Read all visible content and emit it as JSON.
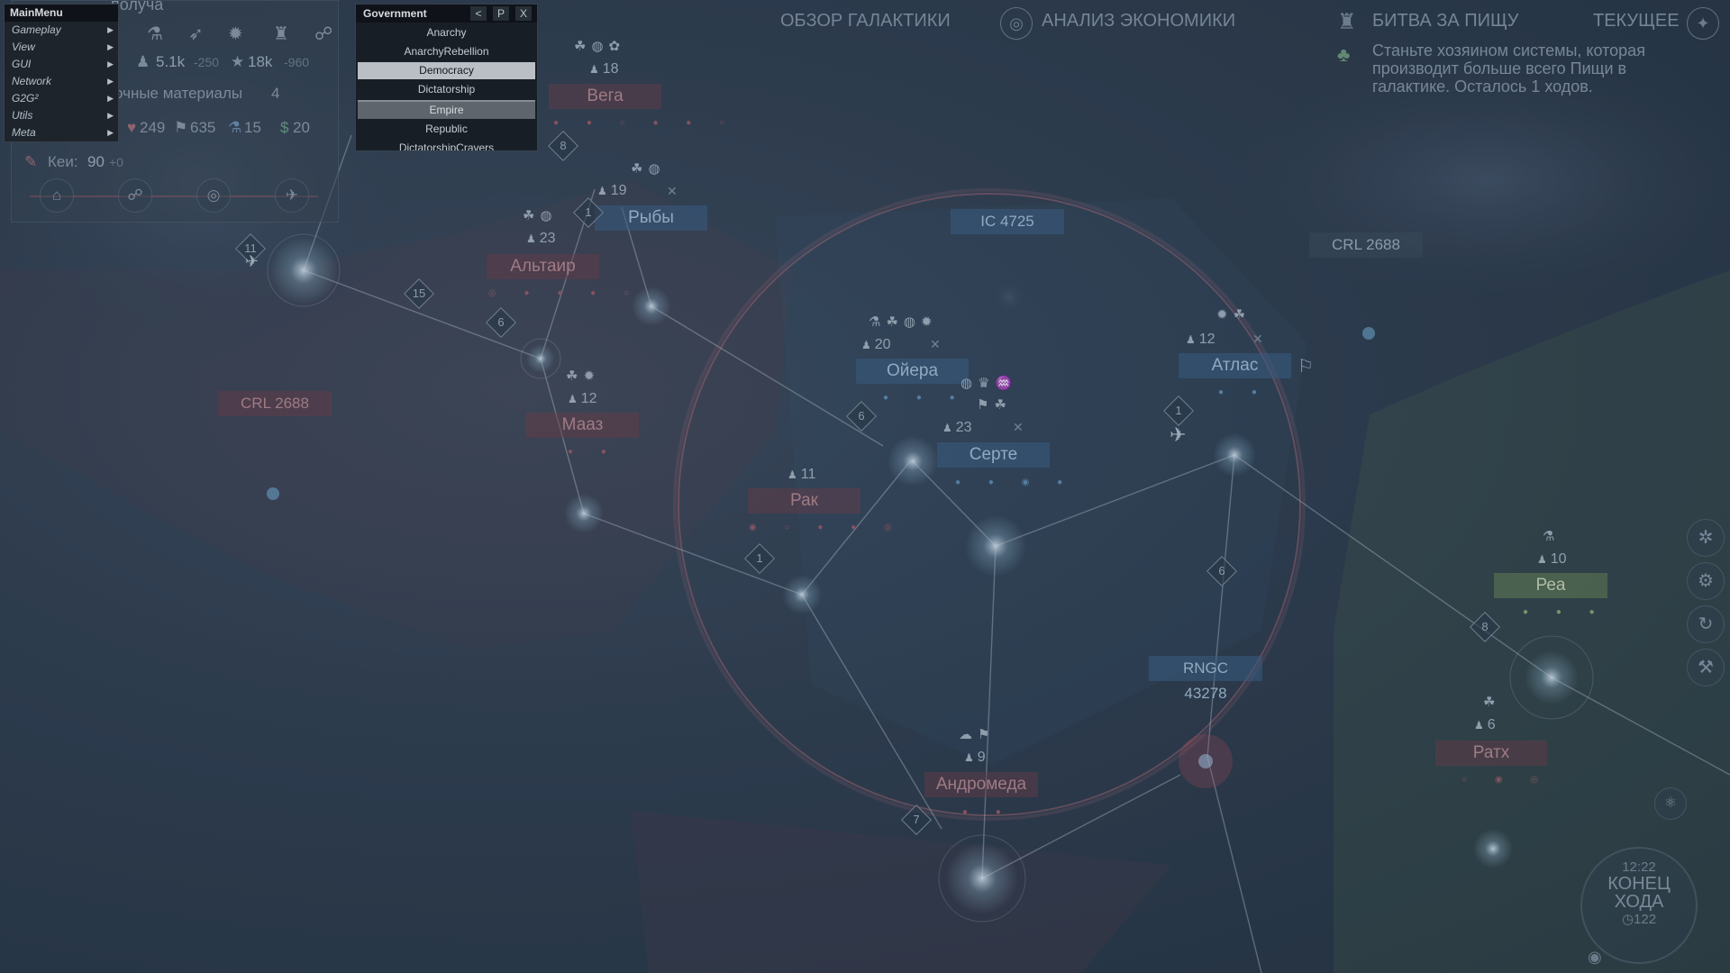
{
  "main_menu": {
    "title": "MainMenu",
    "items": [
      {
        "label": "Gameplay"
      },
      {
        "label": "View"
      },
      {
        "label": "GUI"
      },
      {
        "label": "Network"
      },
      {
        "label": "G2G²"
      },
      {
        "label": "Utils"
      },
      {
        "label": "Meta"
      }
    ]
  },
  "government_window": {
    "title": "Government",
    "buttons": [
      "<",
      "P",
      "X"
    ],
    "options": [
      {
        "label": "Anarchy"
      },
      {
        "label": "AnarchyRebellion"
      },
      {
        "label": "Democracy",
        "selected": true
      },
      {
        "label": "Dictatorship"
      },
      {
        "label": "Empire"
      },
      {
        "label": "Republic"
      },
      {
        "label": "DictatorshipCravers"
      }
    ]
  },
  "resources": {
    "top_partial": "получа",
    "population": "5.1k",
    "population_delta": "-250",
    "influence": "18k",
    "influence_delta": "-960",
    "materials_label": "очные материалы",
    "materials_value": "4",
    "stat1": "249",
    "stat2": "635",
    "stat3": "15",
    "stat4": "20",
    "keys_label": "Кеи:",
    "keys_value": "90",
    "keys_delta": "+0"
  },
  "header": {
    "galaxy_overview": "ОБЗОР ГАЛАКТИКИ",
    "economy_analysis": "АНАЛИЗ ЭКОНОМИКИ",
    "quest_title": "БИТВА ЗА ПИЩУ",
    "current": "ТЕКУЩЕЕ",
    "objective": "Станьте хозяином системы, которая производит больше всего Пищи в галактике. Осталось 1 ходов."
  },
  "systems": [
    {
      "name": "Вега",
      "pop": "18",
      "style": "red"
    },
    {
      "name": "Рыбы",
      "pop": "19",
      "style": "blue"
    },
    {
      "name": "Альтаир",
      "pop": "23",
      "style": "red"
    },
    {
      "name": "Мааз",
      "pop": "12",
      "style": "red"
    },
    {
      "name": "Ойера",
      "pop": "20",
      "style": "blue"
    },
    {
      "name": "Серте",
      "pop": "23",
      "style": "blue"
    },
    {
      "name": "Атлас",
      "pop": "12",
      "style": "blue"
    },
    {
      "name": "Рак",
      "pop": "11",
      "style": "red"
    },
    {
      "name": "Андромеда",
      "pop": "9",
      "style": "red"
    },
    {
      "name": "Реа",
      "pop": "10",
      "style": "green"
    },
    {
      "name": "Ратх",
      "pop": "6",
      "style": "red"
    },
    {
      "name": "IC 4725",
      "style": "plain-blue"
    },
    {
      "name": "CRL 2688",
      "style": "plain"
    },
    {
      "name": "CRL 2688",
      "style": "plain-red"
    },
    {
      "name": "RNGC 43278",
      "style": "plain-blue"
    }
  ],
  "lane_numbers": [
    "8",
    "1",
    "11",
    "15",
    "6",
    "6",
    "1",
    "1",
    "6",
    "7",
    "8"
  ],
  "end_turn": {
    "time": "12:22",
    "label_line1": "КОНЕЦ",
    "label_line2": "ХОДА",
    "turn": "122"
  },
  "colors": {
    "background": "#2f3d4f",
    "red_label": "#784650",
    "blue_label": "#3c648c",
    "green_label": "#6e8c5a",
    "menu_bg": "#1b2026"
  }
}
